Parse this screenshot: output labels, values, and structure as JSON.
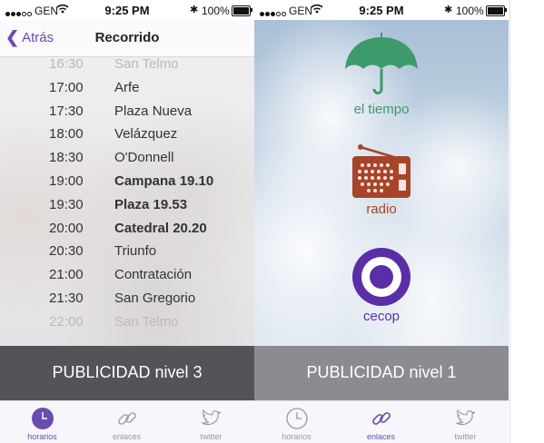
{
  "status_bar": {
    "carrier": "GEN",
    "time": "9:25 PM",
    "battery": "100%"
  },
  "left_screen": {
    "nav": {
      "back_label": "Atrás",
      "title": "Recorrido"
    },
    "schedule": [
      {
        "time": "16:30",
        "place": "San Telmo",
        "style": "faded"
      },
      {
        "time": "17:00",
        "place": "Arfe",
        "style": "normal"
      },
      {
        "time": "17:30",
        "place": "Plaza Nueva",
        "style": "normal"
      },
      {
        "time": "18:00",
        "place": "Velázquez",
        "style": "normal"
      },
      {
        "time": "18:30",
        "place": "O'Donnell",
        "style": "normal"
      },
      {
        "time": "19:00",
        "place": "Campana 19.10",
        "style": "bold"
      },
      {
        "time": "19:30",
        "place": "Plaza 19.53",
        "style": "bold"
      },
      {
        "time": "20:00",
        "place": "Catedral 20.20",
        "style": "bold"
      },
      {
        "time": "20:30",
        "place": "Triunfo",
        "style": "normal"
      },
      {
        "time": "21:00",
        "place": "Contratación",
        "style": "normal"
      },
      {
        "time": "21:30",
        "place": "San Gregorio",
        "style": "normal"
      },
      {
        "time": "22:00",
        "place": "San Telmo",
        "style": "faded"
      }
    ],
    "banner": "PUBLICIDAD nivel 3"
  },
  "right_screen": {
    "links": [
      {
        "label": "el tiempo",
        "icon": "umbrella-icon",
        "color": "#3d9a6a"
      },
      {
        "label": "radio",
        "icon": "radio-icon",
        "color": "#a8442a"
      },
      {
        "label": "cecop",
        "icon": "target-icon",
        "color": "#5a2ea6"
      }
    ],
    "banner": "PUBLICIDAD nivel 1"
  },
  "tabs": [
    {
      "label": "horarios",
      "icon": "clock-icon"
    },
    {
      "label": "enlaces",
      "icon": "chain-link-icon"
    },
    {
      "label": "twitter",
      "icon": "twitter-bird-icon"
    }
  ],
  "left_active_tab": "horarios",
  "right_active_tab": "enlaces",
  "colors": {
    "accent": "#6a4bb0",
    "inactive": "#999999"
  }
}
